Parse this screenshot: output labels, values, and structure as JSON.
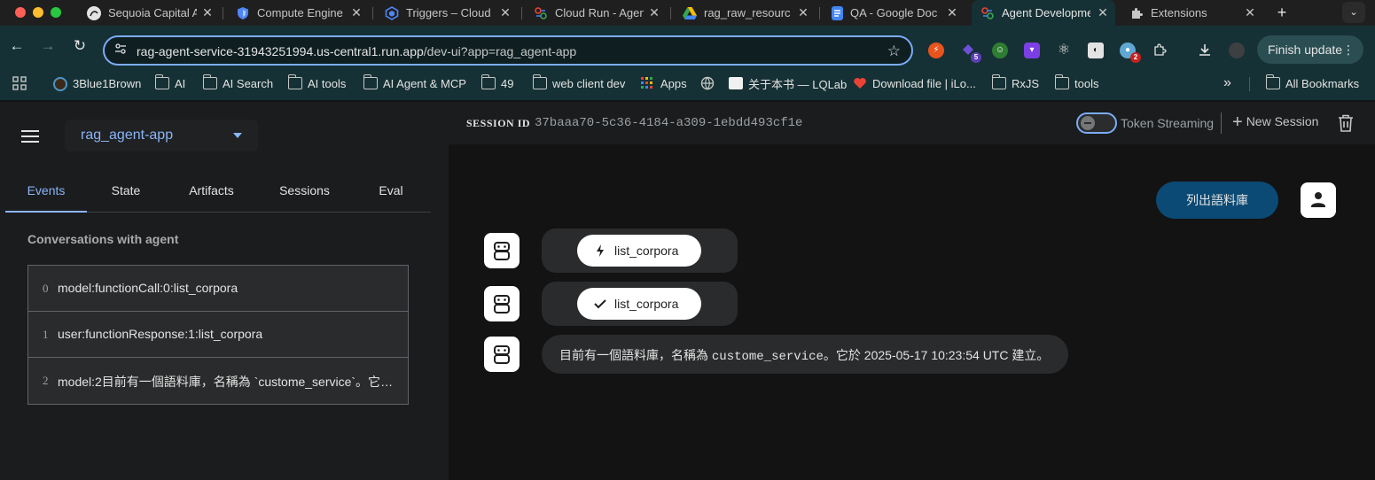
{
  "browser": {
    "tabs": [
      {
        "label": "Sequoia Capital A",
        "icon": "sequoia-icon"
      },
      {
        "label": "Compute Engine",
        "icon": "shield-icon"
      },
      {
        "label": "Triggers – Cloud",
        "icon": "cloud-build-icon"
      },
      {
        "label": "Cloud Run - Agen",
        "icon": "cloud-run-icon"
      },
      {
        "label": "rag_raw_resourc",
        "icon": "google-drive-icon"
      },
      {
        "label": "QA - Google Doc",
        "icon": "google-docs-icon"
      },
      {
        "label": "Agent Developme",
        "icon": "agent-icon",
        "active": true
      },
      {
        "label": "Extensions",
        "icon": "puzzle-icon"
      }
    ],
    "url_host": "rag-agent-service-31943251994.us-central1.run.app",
    "url_path": "/dev-ui?app=rag_agent-app",
    "extensions_badges": [
      "5",
      "2"
    ],
    "finish_update": "Finish update",
    "bookmarks": [
      {
        "label": "3Blue1Brown",
        "type": "site"
      },
      {
        "label": "AI",
        "type": "folder"
      },
      {
        "label": "AI Search",
        "type": "folder"
      },
      {
        "label": "AI tools",
        "type": "folder"
      },
      {
        "label": "AI Agent & MCP",
        "type": "folder"
      },
      {
        "label": "49",
        "type": "folder"
      },
      {
        "label": "web client dev",
        "type": "folder"
      },
      {
        "label": "Apps",
        "type": "apps"
      },
      {
        "label": "关于本书 — LQLab",
        "type": "site"
      },
      {
        "label": "Download file | iLo...",
        "type": "site"
      },
      {
        "label": "RxJS",
        "type": "folder"
      },
      {
        "label": "tools",
        "type": "folder"
      }
    ],
    "all_bookmarks": "All Bookmarks"
  },
  "app": {
    "selected_app": "rag_agent-app",
    "tabs": [
      "Events",
      "State",
      "Artifacts",
      "Sessions",
      "Eval"
    ],
    "conversations_heading": "Conversations with agent",
    "events": [
      {
        "index": "0",
        "text": "model:functionCall:0:list_corpora"
      },
      {
        "index": "1",
        "text": "user:functionResponse:1:list_corpora"
      },
      {
        "index": "2",
        "text": "model:2目前有一個語料庫，名稱為 `custome_service`。它於 2025-05-17 10:23:54 UTC 建立。"
      }
    ],
    "session": {
      "label": "SESSION ID",
      "id": "37baaa70-5c36-4184-a309-1ebdd493cf1e",
      "token_streaming": "Token Streaming",
      "new_session": "New Session"
    },
    "chat": {
      "user_message": "列出語料庫",
      "function_call": "list_corpora",
      "function_response": "list_corpora",
      "answer_prefix": "目前有一個語料庫，名稱為 ",
      "answer_code": "custome_service",
      "answer_suffix": "。它於 2025-05-17 10:23:54 UTC 建立。"
    }
  },
  "colors": {
    "accent": "#8ab4f8",
    "user_bubble": "#0b4a74",
    "toolbar": "#163135"
  }
}
